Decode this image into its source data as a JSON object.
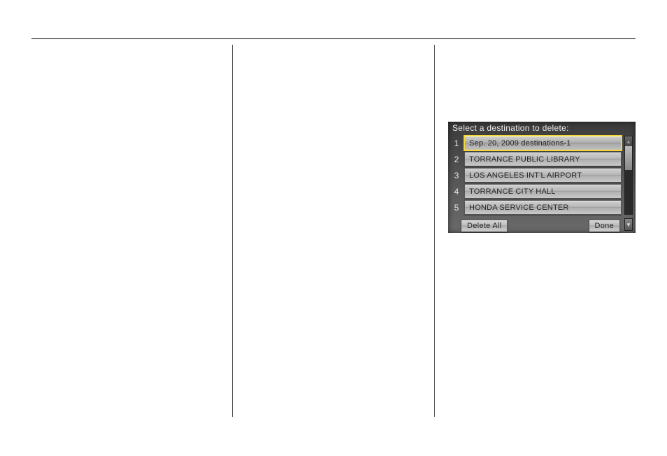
{
  "nav": {
    "title": "Select a destination to delete:",
    "items": [
      {
        "num": "1",
        "label": "Sep. 20, 2009 destinations-1",
        "selected": true
      },
      {
        "num": "2",
        "label": "TORRANCE PUBLIC LIBRARY",
        "selected": false
      },
      {
        "num": "3",
        "label": "LOS ANGELES INT'L AIRPORT",
        "selected": false
      },
      {
        "num": "4",
        "label": "TORRANCE CITY HALL",
        "selected": false
      },
      {
        "num": "5",
        "label": "HONDA SERVICE CENTER",
        "selected": false
      }
    ],
    "delete_all_label": "Delete All",
    "done_label": "Done"
  }
}
